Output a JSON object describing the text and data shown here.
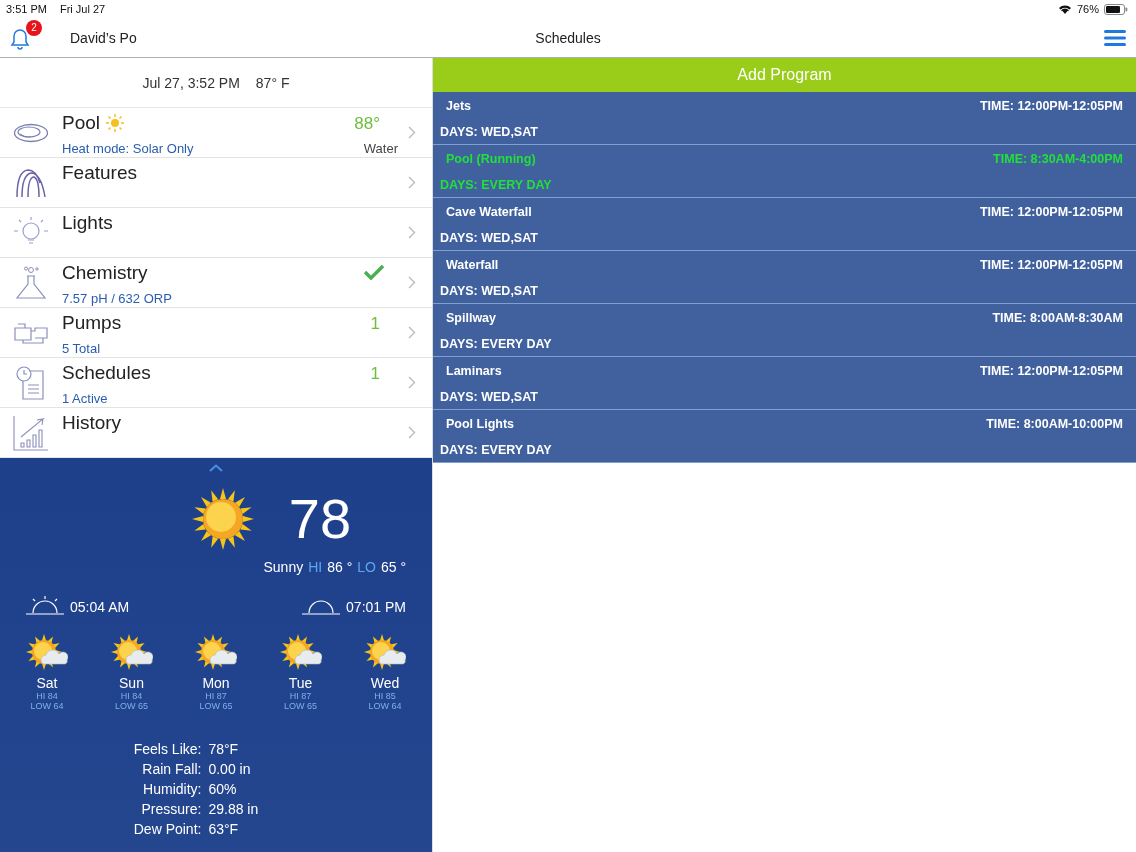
{
  "status_bar": {
    "time": "3:51 PM",
    "date": "Fri Jul 27",
    "battery": "76%"
  },
  "nav": {
    "badge": "2",
    "pool_name": "David’s Po",
    "title": "Schedules"
  },
  "summary": {
    "datetime": "Jul 27, 3:52 PM",
    "air_temp": "87° F"
  },
  "menu": [
    {
      "label": "Pool",
      "heating": true,
      "ok": false,
      "detail": "Heat mode: Solar Only",
      "value": "88°",
      "unit": "Water"
    },
    {
      "label": "Features",
      "heating": false,
      "ok": false
    },
    {
      "label": "Lights",
      "heating": false,
      "ok": false
    },
    {
      "label": "Chemistry",
      "heating": false,
      "ok": true,
      "detail": "7.57 pH / 632 ORP"
    },
    {
      "label": "Pumps",
      "heating": false,
      "ok": false,
      "detail": "5 Total",
      "value": "1"
    },
    {
      "label": "Schedules",
      "heating": false,
      "ok": false,
      "detail": "1 Active",
      "value": "1"
    },
    {
      "label": "History",
      "heating": false,
      "ok": false
    }
  ],
  "weather": {
    "temp": "78",
    "condition": "Sunny",
    "hi_label": "HI",
    "hi": "86 °",
    "lo_label": "LO",
    "lo": "65 °",
    "sunrise": "05:04 AM",
    "sunset": "07:01 PM",
    "forecast": [
      {
        "day": "Sat",
        "hi": "HI 84",
        "low": "LOW 64"
      },
      {
        "day": "Sun",
        "hi": "HI 84",
        "low": "LOW 65"
      },
      {
        "day": "Mon",
        "hi": "HI 87",
        "low": "LOW 65"
      },
      {
        "day": "Tue",
        "hi": "HI 87",
        "low": "LOW 65"
      },
      {
        "day": "Wed",
        "hi": "HI 85",
        "low": "LOW 64"
      }
    ],
    "details": [
      {
        "label": "Feels Like:",
        "value": "78°F"
      },
      {
        "label": "Rain Fall:",
        "value": "0.00 in"
      },
      {
        "label": "Humidity:",
        "value": "60%"
      },
      {
        "label": "Pressure:",
        "value": "29.88 in"
      },
      {
        "label": "Dew Point:",
        "value": "63°F"
      }
    ]
  },
  "add_button": "Add Program",
  "schedules": [
    {
      "name": "Jets",
      "time": "TIME: 12:00PM-12:05PM",
      "days": "DAYS: WED,SAT",
      "running": false
    },
    {
      "name": "Pool (Running)",
      "time": "TIME: 8:30AM-4:00PM",
      "days": "DAYS: EVERY DAY",
      "running": true
    },
    {
      "name": "Cave Waterfall",
      "time": "TIME: 12:00PM-12:05PM",
      "days": "DAYS: WED,SAT",
      "running": false
    },
    {
      "name": "Waterfall",
      "time": "TIME: 12:00PM-12:05PM",
      "days": "DAYS: WED,SAT",
      "running": false
    },
    {
      "name": "Spillway",
      "time": "TIME: 8:00AM-8:30AM",
      "days": "DAYS: EVERY DAY",
      "running": false
    },
    {
      "name": "Laminars",
      "time": "TIME: 12:00PM-12:05PM",
      "days": "DAYS: WED,SAT",
      "running": false
    },
    {
      "name": "Pool Lights",
      "time": "TIME: 8:00AM-10:00PM",
      "days": "DAYS: EVERY DAY",
      "running": false
    }
  ]
}
